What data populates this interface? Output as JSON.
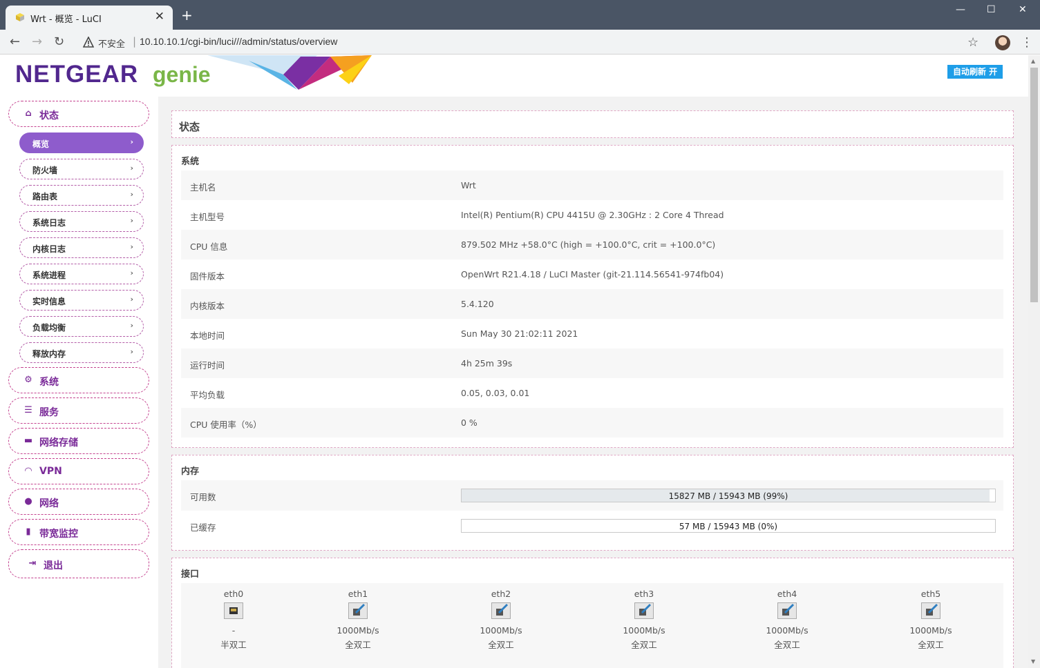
{
  "browser": {
    "tab_title": "Wrt - 概览 - LuCI",
    "tab_close": "✕",
    "new_tab": "+",
    "insecure_label": "不安全",
    "url": "10.10.10.1/cgi-bin/luci///admin/status/overview"
  },
  "header": {
    "logo_brand": "NETGEAR",
    "logo_product": "genie",
    "auto_refresh": "自动刷新 开"
  },
  "sidebar": {
    "status": "状态",
    "sub_items": [
      {
        "label": "概览",
        "active": true
      },
      {
        "label": "防火墙"
      },
      {
        "label": "路由表"
      },
      {
        "label": "系统日志"
      },
      {
        "label": "内核日志"
      },
      {
        "label": "系统进程"
      },
      {
        "label": "实时信息"
      },
      {
        "label": "负载均衡"
      },
      {
        "label": "释放内存"
      }
    ],
    "top_items": [
      {
        "label": "系统",
        "icon": "gears-icon"
      },
      {
        "label": "服务",
        "icon": "list-icon"
      },
      {
        "label": "网络存储",
        "icon": "hdd-icon"
      },
      {
        "label": "VPN",
        "icon": "gauge-icon"
      },
      {
        "label": "网络",
        "icon": "globe-icon"
      },
      {
        "label": "带宽监控",
        "icon": "bar-chart-icon"
      },
      {
        "label": "退出",
        "icon": "logout-icon"
      }
    ]
  },
  "main": {
    "page_title": "状态",
    "system": {
      "title": "系统",
      "rows": [
        {
          "k": "主机名",
          "v": "Wrt"
        },
        {
          "k": "主机型号",
          "v": "Intel(R) Pentium(R) CPU 4415U @ 2.30GHz : 2 Core 4 Thread"
        },
        {
          "k": "CPU 信息",
          "v": "879.502 MHz +58.0°C (high = +100.0°C, crit = +100.0°C)"
        },
        {
          "k": "固件版本",
          "v": "OpenWrt R21.4.18 / LuCI Master (git-21.114.56541-974fb04)"
        },
        {
          "k": "内核版本",
          "v": "5.4.120"
        },
        {
          "k": "本地时间",
          "v": "Sun May 30 21:02:11 2021"
        },
        {
          "k": "运行时间",
          "v": "4h 25m 39s"
        },
        {
          "k": "平均负载",
          "v": "0.05, 0.03, 0.01"
        },
        {
          "k": "CPU 使用率（%）",
          "v": "0 %"
        }
      ]
    },
    "memory": {
      "title": "内存",
      "available_label": "可用数",
      "available_text": "15827 MB / 15943 MB (99%)",
      "available_fraction": 0.99,
      "cached_label": "已缓存",
      "cached_text": "57 MB / 15943 MB (0%)",
      "cached_fraction": 0.0
    },
    "interfaces": {
      "title": "接口",
      "ports": [
        {
          "name": "eth0",
          "speed": "-",
          "duplex": "半双工",
          "connected": false
        },
        {
          "name": "eth1",
          "speed": "1000Mb/s",
          "duplex": "全双工",
          "connected": true
        },
        {
          "name": "eth2",
          "speed": "1000Mb/s",
          "duplex": "全双工",
          "connected": true
        },
        {
          "name": "eth3",
          "speed": "1000Mb/s",
          "duplex": "全双工",
          "connected": true
        },
        {
          "name": "eth4",
          "speed": "1000Mb/s",
          "duplex": "全双工",
          "connected": true
        },
        {
          "name": "eth5",
          "speed": "1000Mb/s",
          "duplex": "全双工",
          "connected": true
        }
      ]
    }
  },
  "colors": {
    "brand_purple": "#51278e",
    "menu_active": "#8e5ccc",
    "menu_border": "#c4428f",
    "refresh_badge": "#1e9ee8"
  }
}
